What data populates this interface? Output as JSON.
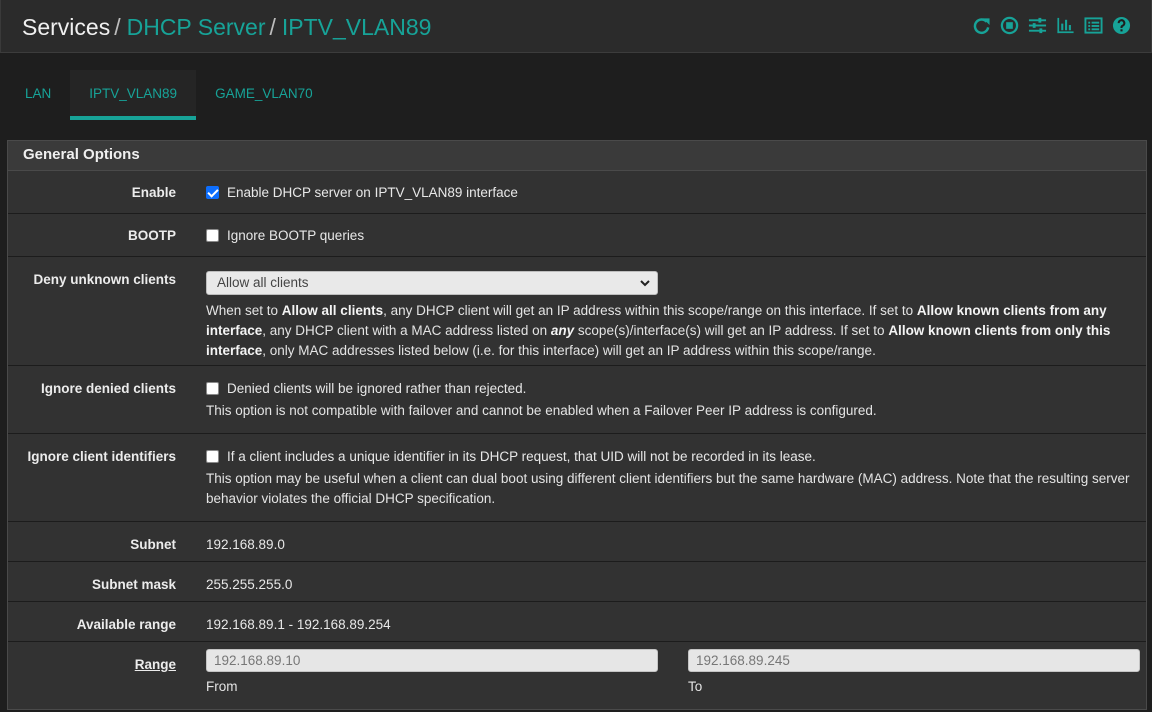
{
  "header": {
    "crumb_root": "Services",
    "crumb_mid": "DHCP Server",
    "crumb_leaf": "IPTV_VLAN89",
    "sep": "/",
    "icons": [
      "reload-icon",
      "stop-icon",
      "sliders-icon",
      "bar-chart-icon",
      "list-icon",
      "help-icon"
    ],
    "accent_color": "#17a398"
  },
  "tabs": [
    {
      "label": "LAN",
      "active": false
    },
    {
      "label": "IPTV_VLAN89",
      "active": true
    },
    {
      "label": "GAME_VLAN70",
      "active": false
    }
  ],
  "panel": {
    "title": "General Options",
    "enable": {
      "label": "Enable",
      "checked": true,
      "text": "Enable DHCP server on IPTV_VLAN89 interface"
    },
    "bootp": {
      "label": "BOOTP",
      "checked": false,
      "text": "Ignore BOOTP queries"
    },
    "deny": {
      "label": "Deny unknown clients",
      "selected": "Allow all clients",
      "h1": "When set to ",
      "b1": "Allow all clients",
      "h2": ", any DHCP client will get an IP address within this scope/range on this interface. If set to ",
      "b2": "Allow known clients from any interface",
      "h3": ", any DHCP client with a MAC address listed on ",
      "i1": "any",
      "h4": " scope(s)/interface(s) will get an IP address. If set to ",
      "b3": "Allow known clients from only this interface",
      "h5": ", only MAC addresses listed below (i.e. for this interface) will get an IP address within this scope/range."
    },
    "ignore_denied": {
      "label": "Ignore denied clients",
      "checked": false,
      "text": "Denied clients will be ignored rather than rejected.",
      "help": "This option is not compatible with failover and cannot be enabled when a Failover Peer IP address is configured."
    },
    "ignore_ids": {
      "label": "Ignore client identifiers",
      "checked": false,
      "text": "If a client includes a unique identifier in its DHCP request, that UID will not be recorded in its lease.",
      "help": "This option may be useful when a client can dual boot using different client identifiers but the same hardware (MAC) address. Note that the resulting server behavior violates the official DHCP specification."
    },
    "subnet": {
      "label": "Subnet",
      "value": "192.168.89.0"
    },
    "subnet_mask": {
      "label": "Subnet mask",
      "value": "255.255.255.0"
    },
    "available_range": {
      "label": "Available range",
      "value": "192.168.89.1 - 192.168.89.254"
    },
    "range": {
      "label": "Range",
      "from_placeholder": "192.168.89.10",
      "to_placeholder": "192.168.89.245",
      "from_label": "From",
      "to_label": "To"
    }
  }
}
